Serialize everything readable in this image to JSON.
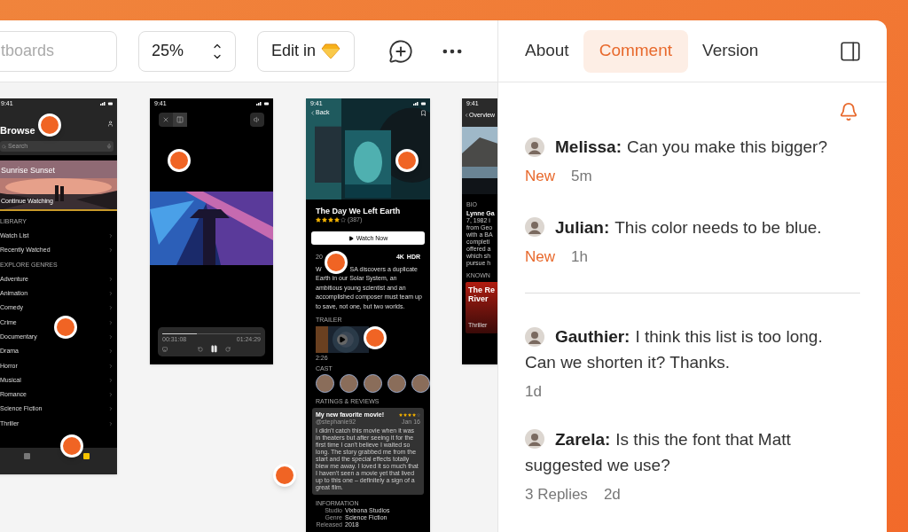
{
  "toolbar": {
    "search_placeholder": "tboards",
    "zoom": "25%",
    "edit_label": "Edit in"
  },
  "tabs": [
    {
      "label": "About",
      "selected": false
    },
    {
      "label": "Comment",
      "selected": true
    },
    {
      "label": "Version",
      "selected": false
    }
  ],
  "comment_groups": [
    [
      {
        "author": "Melissa:",
        "lines": [
          "Can you make this bigger?"
        ],
        "status": "New",
        "time": "5m"
      },
      {
        "author": "Julian:",
        "lines": [
          "This color needs to be blue."
        ],
        "status": "New",
        "time": "1h"
      }
    ],
    [
      {
        "author": "Gauthier:",
        "lines": [
          "I think this list is too long.",
          "Can we shorten it? Thanks."
        ],
        "time": "1d"
      },
      {
        "author": "Zarela:",
        "lines": [
          "Is this the font that Matt",
          "suggested we use?"
        ],
        "replies": "3 Replies",
        "time": "2d"
      }
    ]
  ],
  "browse": {
    "time": "9:41",
    "title": "Browse",
    "search": "Search",
    "hero_title": "Sunrise Sunset",
    "hero_caption": "Continue Watching",
    "sections": [
      {
        "heading": "LIBRARY",
        "items": [
          "Watch List",
          "Recently Watched"
        ]
      },
      {
        "heading": "EXPLORE GENRES",
        "items": [
          "Adventure",
          "Animation",
          "Comedy",
          "Crime",
          "Documentary",
          "Drama",
          "Horror",
          "Musical",
          "Romance",
          "Science Fiction",
          "Thriller"
        ]
      }
    ]
  },
  "player": {
    "time": "9:41",
    "elapsed": "00:31:08",
    "remaining": "01:24:29",
    "level": 0.35
  },
  "detail": {
    "time": "9:41",
    "back": "Back",
    "title": "The Day We Left Earth",
    "stars": 4,
    "rating_count": "(387)",
    "watch": "Watch Now",
    "year": "20",
    "badges": [
      "4K",
      "HDR"
    ],
    "description_lead": "W",
    "description_first": "SA discovers a duplicate",
    "description": "Earth in our Solar System, an ambitious young scientist and an accomplished composer must team up to save, not one, but two worlds.",
    "trailer_heading": "TRAILER",
    "trailer_length": "2:26",
    "cast_heading": "CAST",
    "reviews_heading": "RATINGS & REVIEWS",
    "review": {
      "title": "My new favorite movie!",
      "stars": 4,
      "user": "@stephanie92",
      "date": "Jan 16",
      "body": "I didn't catch this movie when it was in theaters but after seeing it for the first time I can't believe I waited so long. The story grabbed me from the start and the special effects totally blew me away. I loved it so much that I haven't seen a movie yet that lived up to this one – definitely a sign of a great film."
    },
    "info_heading": "INFORMATION",
    "info": [
      {
        "key": "Studio",
        "value": "Vixbona Studios"
      },
      {
        "key": "Genre",
        "value": "Science Fiction"
      },
      {
        "key": "Released",
        "value": "2018"
      }
    ]
  },
  "profile": {
    "time": "9:41",
    "back": "Overview",
    "bio_heading": "BIO",
    "bio_name": "Lynne Ga",
    "bio_lines": [
      "7, 1982 i",
      "from Geo",
      "with a BA",
      "completi",
      "offered a",
      "which sh",
      "pursue h"
    ],
    "known_heading": "KNOWN",
    "card_title": "The Re",
    "card_title_2": "River",
    "card_genre": "Thriller"
  }
}
